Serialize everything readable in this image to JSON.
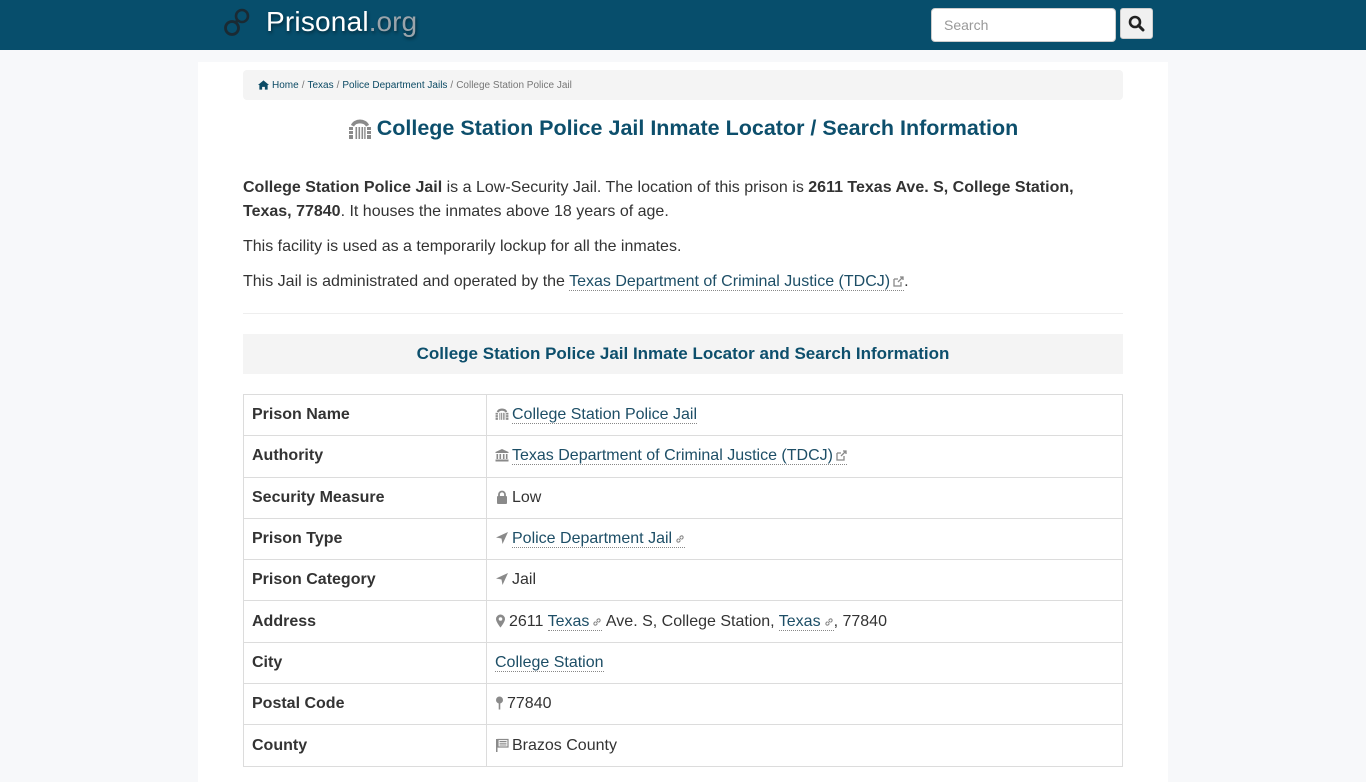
{
  "header": {
    "brand_name": "Prisonal",
    "brand_tld": ".org",
    "logo_icon": "handcuffs-icon",
    "search": {
      "placeholder": "Search",
      "value": "",
      "button_icon": "search-icon"
    }
  },
  "breadcrumb": {
    "home_icon": "home-icon",
    "items": [
      {
        "label": "Home"
      },
      {
        "label": "Texas"
      },
      {
        "label": "Police Department Jails"
      }
    ],
    "current": "College Station Police Jail"
  },
  "page": {
    "title_icon": "prison-gate-icon",
    "title": "College Station Police Jail Inmate Locator / Search Information"
  },
  "intro": {
    "p1": {
      "name": "College Station Police Jail",
      "mid": " is a Low-Security Jail. The location of this prison is ",
      "address": "2611 Texas Ave. S, College Station, Texas, 77840",
      "end": ". It houses the inmates above 18 years of age."
    },
    "p2": "This facility is used as a temporarily lockup for all the inmates.",
    "p3": {
      "pre": "This Jail is administrated and operated by the ",
      "link": "Texas Department of Criminal Justice (TDCJ)",
      "post": "."
    }
  },
  "section": {
    "heading": "College Station Police Jail Inmate Locator and Search Information"
  },
  "table": {
    "rows": [
      {
        "label": "Prison Name",
        "icon": "prison-gate-icon",
        "value": "College Station Police Jail"
      },
      {
        "label": "Authority",
        "icon": "institution-icon",
        "value": "Texas Department of Criminal Justice (TDCJ)"
      },
      {
        "label": "Security Measure",
        "icon": "lock-icon",
        "value": "Low"
      },
      {
        "label": "Prison Type",
        "icon": "location-arrow-icon",
        "value": "Police Department Jail"
      },
      {
        "label": "Prison Category",
        "icon": "location-arrow-icon",
        "value": "Jail"
      },
      {
        "label": "Address",
        "icon": "map-marker-icon",
        "value_parts": [
          "2611 ",
          "Texas",
          " Ave. S, College Station, ",
          "Texas",
          ", 77840"
        ]
      },
      {
        "label": "City",
        "icon": "",
        "value": "College Station"
      },
      {
        "label": "Postal Code",
        "icon": "map-pin-icon",
        "value": "77840"
      },
      {
        "label": "County",
        "icon": "flag-icon",
        "value": "Brazos County"
      }
    ]
  },
  "colors": {
    "navbar": "#074e6c",
    "heading": "#0d4f6c",
    "link": "#1d4e66"
  }
}
